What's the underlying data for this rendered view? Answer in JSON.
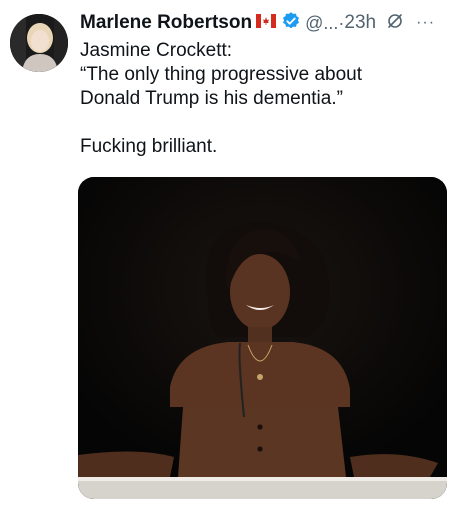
{
  "tweet": {
    "author": {
      "name": "Marlene Robertson",
      "handle": "@...",
      "separator": "·",
      "time": "23h",
      "flag_icon": "canada-flag-icon",
      "verified_icon": "verified-badge-icon",
      "grok_icon": "grok-icon",
      "more_icon": "more-options-icon",
      "more_label": "···"
    },
    "text": {
      "line1": "Jasmine Crockett:",
      "line2": "“The only thing progressive about",
      "line3": "Donald Trump is his dementia.”",
      "line4": "Fucking brilliant."
    },
    "colors": {
      "name": "#0f1419",
      "secondary": "#536471",
      "verified": "#1d9bf0",
      "media_bg": "#070707"
    }
  }
}
